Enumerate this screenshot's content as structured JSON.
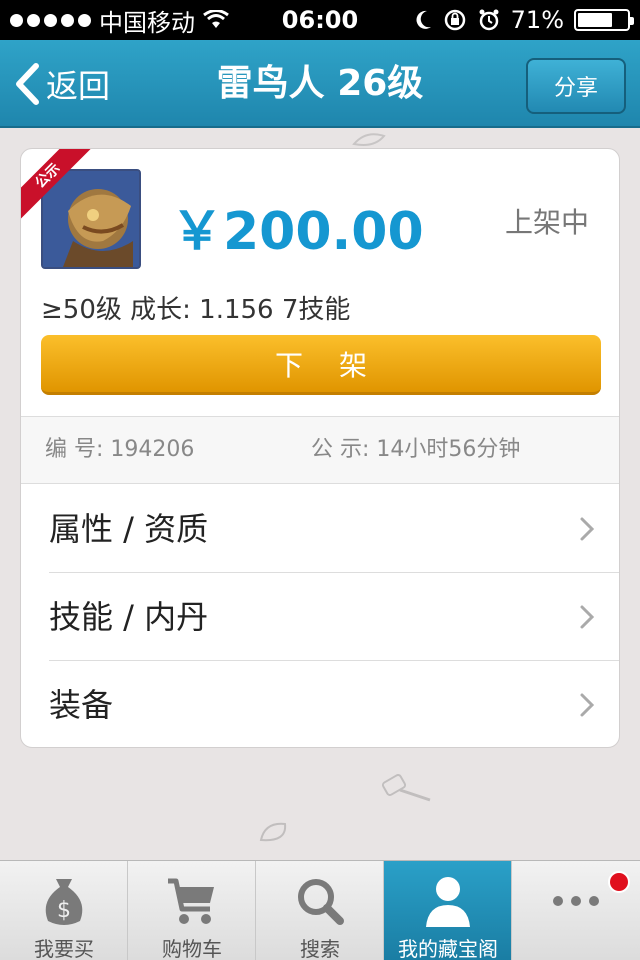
{
  "status_bar": {
    "carrier": "中国移动",
    "time": "06:00",
    "battery_text": "71%",
    "battery_level": 0.71,
    "icons": [
      "signal-dots-icon",
      "wifi-icon",
      "moon-icon",
      "orientation-lock-icon",
      "alarm-icon",
      "battery-icon"
    ]
  },
  "nav": {
    "back_label": "返回",
    "title": "雷鸟人 26级",
    "share_label": "分享"
  },
  "item": {
    "ribbon_label": "公示",
    "price": "￥200.00",
    "status": "上架中",
    "meta": "≥50级 成长: 1.156  7技能",
    "takedown_label": "下架",
    "id_label": "编  号: 194206",
    "publicity_label": "公  示: 14小时56分钟"
  },
  "menu": [
    {
      "label": "属性 / 资质"
    },
    {
      "label": "技能 / 内丹"
    },
    {
      "label": "装备"
    }
  ],
  "tabs": [
    {
      "label": "我要买",
      "icon": "money-bag-icon",
      "active": false
    },
    {
      "label": "购物车",
      "icon": "cart-icon",
      "active": false
    },
    {
      "label": "搜索",
      "icon": "search-icon",
      "active": false
    },
    {
      "label": "我的藏宝阁",
      "icon": "user-icon",
      "active": true
    },
    {
      "label": "",
      "icon": "more-icon",
      "active": false,
      "badge": true
    }
  ],
  "colors": {
    "accent": "#1f86ad",
    "price": "#1597d1",
    "button": "#f0a818",
    "ribbon": "#c9102a"
  }
}
